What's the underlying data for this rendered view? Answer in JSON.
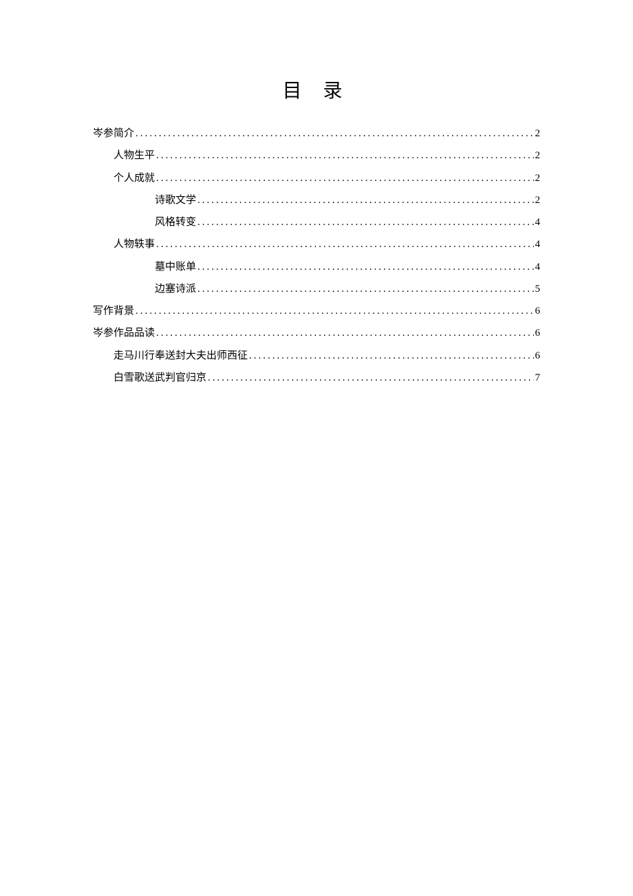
{
  "title": "目 录",
  "toc": [
    {
      "label": "岑参简介",
      "page": "2",
      "level": 1
    },
    {
      "label": "人物生平",
      "page": "2",
      "level": 2
    },
    {
      "label": "个人成就",
      "page": "2",
      "level": 2
    },
    {
      "label": "诗歌文学",
      "page": "2",
      "level": 3
    },
    {
      "label": "风格转变",
      "page": "4",
      "level": 3
    },
    {
      "label": "人物轶事",
      "page": "4",
      "level": 2
    },
    {
      "label": "墓中账单",
      "page": "4",
      "level": 3
    },
    {
      "label": "边塞诗派",
      "page": "5",
      "level": 3
    },
    {
      "label": "写作背景",
      "page": "6",
      "level": 1
    },
    {
      "label": "岑参作品品读",
      "page": "6",
      "level": 1
    },
    {
      "label": "走马川行奉送封大夫出师西征",
      "page": "6",
      "level": 2
    },
    {
      "label": "白雪歌送武判官归京",
      "page": "7",
      "level": 2
    }
  ]
}
